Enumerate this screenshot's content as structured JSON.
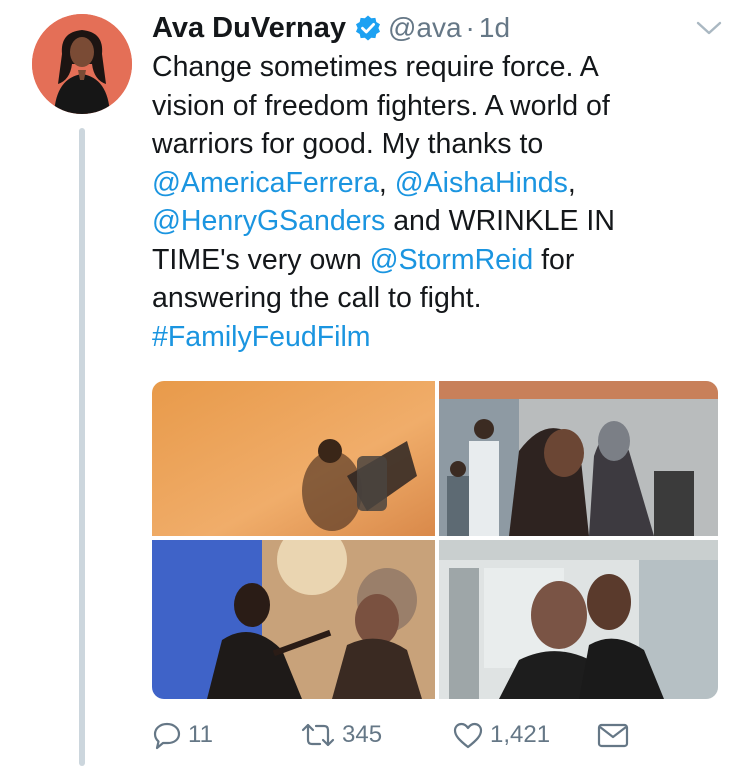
{
  "tweet": {
    "author_name": "Ava DuVernay",
    "handle": "@ava",
    "separator": "·",
    "time": "1d",
    "text_lines": [
      [
        {
          "t": "Change sometimes require force. A",
          "link": false
        }
      ],
      [
        {
          "t": "vision of freedom fighters. A world of",
          "link": false
        }
      ],
      [
        {
          "t": "warriors for good. My thanks to",
          "link": false
        }
      ],
      [
        {
          "t": "@AmericaFerrera",
          "link": true
        },
        {
          "t": ", ",
          "link": false
        },
        {
          "t": "@AishaHinds",
          "link": true
        },
        {
          "t": ",",
          "link": false
        }
      ],
      [
        {
          "t": "@HenryGSanders",
          "link": true
        },
        {
          "t": " and WRINKLE IN",
          "link": false
        }
      ],
      [
        {
          "t": "TIME's very own ",
          "link": false
        },
        {
          "t": "@StormReid",
          "link": true
        },
        {
          "t": " for",
          "link": false
        }
      ],
      [
        {
          "t": "answering the call to fight.",
          "link": false
        }
      ],
      [
        {
          "t": "#FamilyFeudFilm",
          "link": true
        }
      ]
    ]
  },
  "actions": {
    "reply_count": "11",
    "retweet_count": "345",
    "like_count": "1,421"
  },
  "icons": {
    "verified": "verified-badge-icon",
    "caret": "chevron-down-icon",
    "reply": "reply-icon",
    "retweet": "retweet-icon",
    "like": "heart-icon",
    "dm": "envelope-icon"
  },
  "colors": {
    "link": "#1b95e0",
    "verified": "#1da1f2",
    "muted": "#657786",
    "thread_line": "#ccd6dd"
  }
}
